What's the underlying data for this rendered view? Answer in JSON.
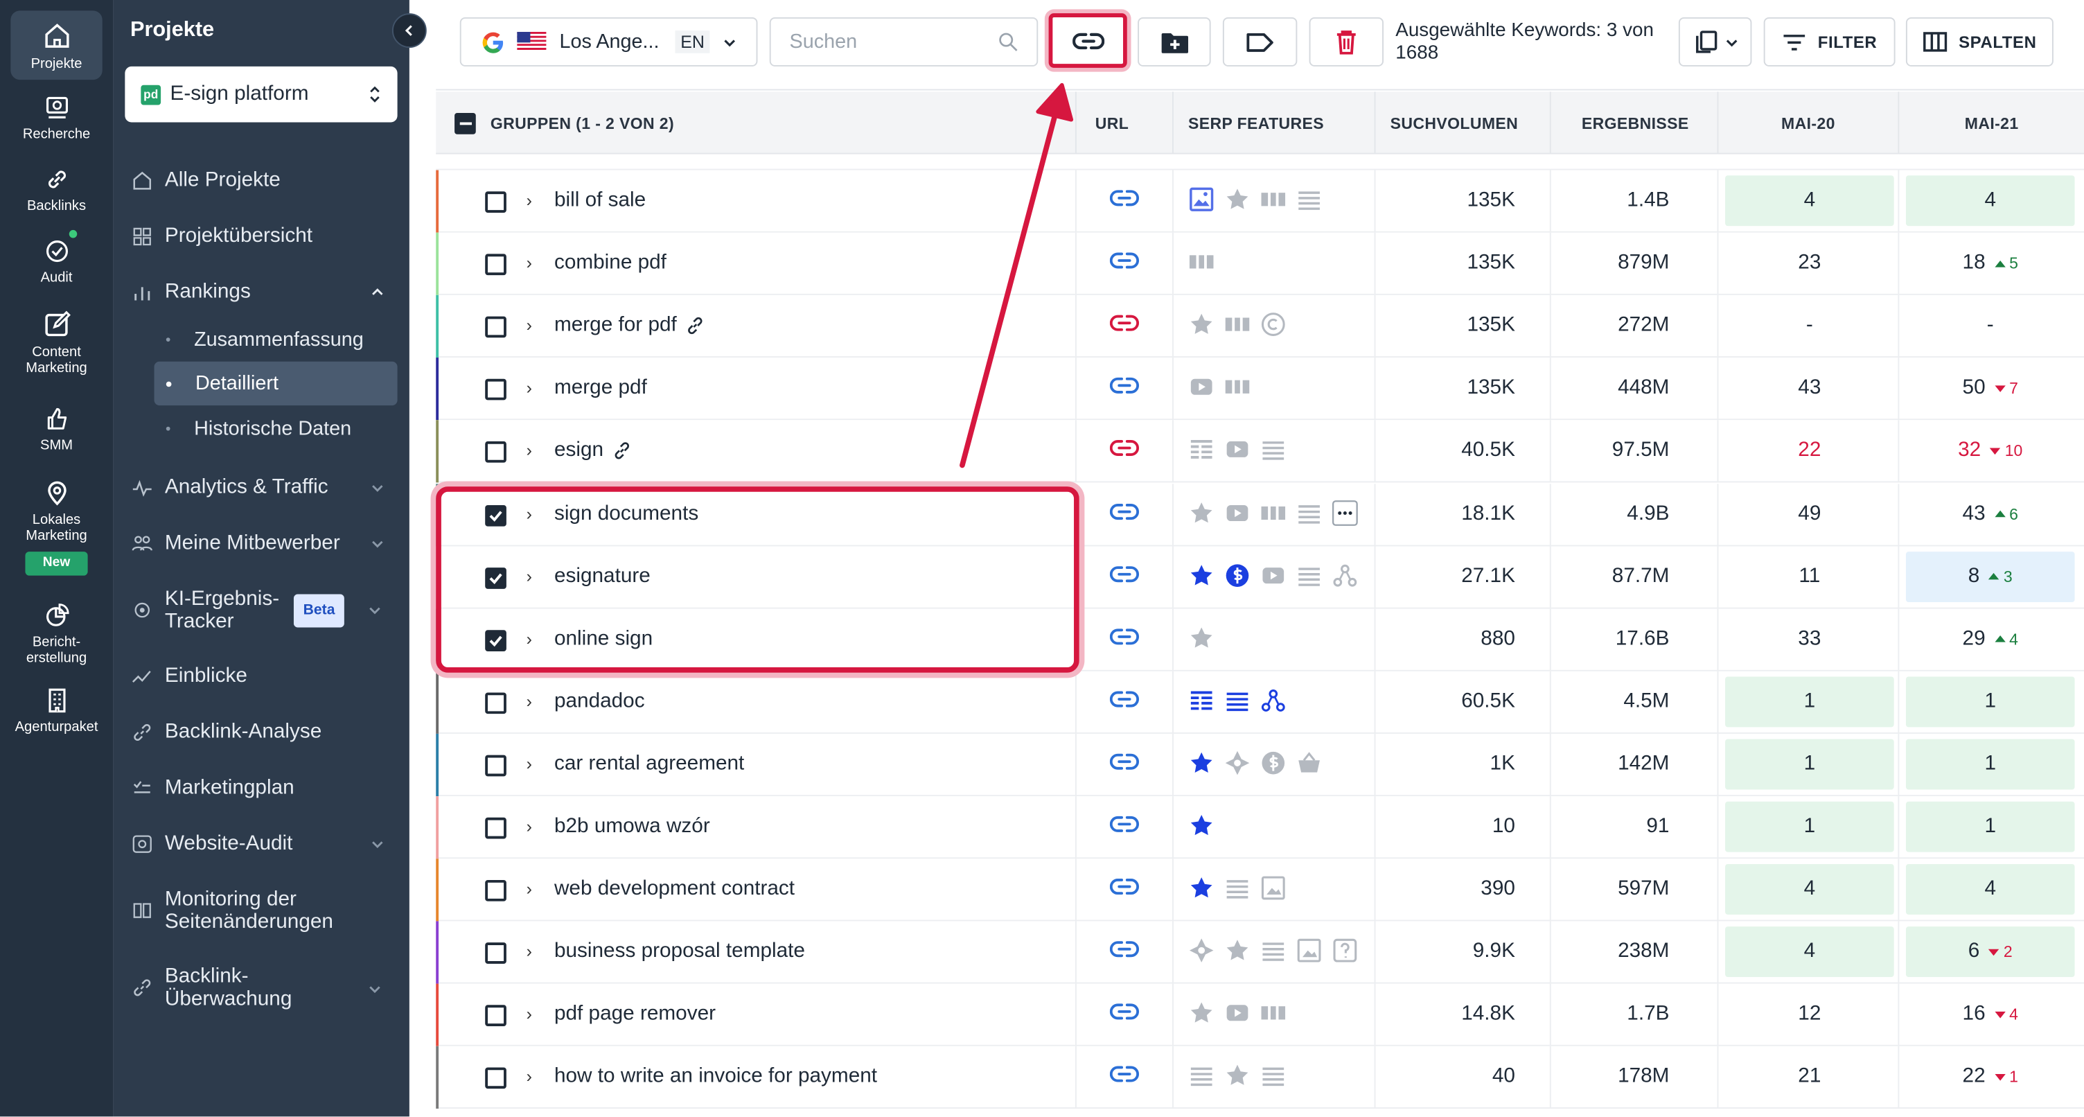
{
  "rail": [
    {
      "label": "Projekte",
      "icon": "home-icon",
      "active": true
    },
    {
      "label": "Recherche",
      "icon": "research-icon"
    },
    {
      "label": "Backlinks",
      "icon": "link-icon"
    },
    {
      "label": "Audit",
      "icon": "audit-icon"
    },
    {
      "label": "Content Marketing",
      "icon": "edit-icon"
    },
    {
      "label": "SMM",
      "icon": "thumbs-up-icon"
    },
    {
      "label": "Lokales Marketing",
      "icon": "location-pin-icon",
      "badge": "New"
    },
    {
      "label": "Bericht-erstellung",
      "icon": "report-icon"
    },
    {
      "label": "Agenturpaket",
      "icon": "building-icon"
    }
  ],
  "side": {
    "title": "Projekte",
    "project": "E-sign platform",
    "project_logo": "pd",
    "nav": {
      "alle": "Alle Projekte",
      "uebersicht": "Projektübersicht",
      "rankings": "Rankings",
      "zusammenfassung": "Zusammenfassung",
      "detailliert": "Detailliert",
      "historische": "Historische Daten",
      "analytics": "Analytics & Traffic",
      "mitbewerber": "Meine Mitbewerber",
      "ki": "KI-Ergebnis-Tracker",
      "ki_badge": "Beta",
      "einblicke": "Einblicke",
      "backlink_analyse": "Backlink-Analyse",
      "marketingplan": "Marketingplan",
      "website_audit": "Website-Audit",
      "monitoring": "Monitoring der Seitenänderungen",
      "backlink_ueberwachung": "Backlink-Überwachung"
    }
  },
  "toolbar": {
    "location": "Los Ange...",
    "language": "EN",
    "search_placeholder": "Suchen",
    "selected_text": "Ausgewählte Keywords: 3 von 1688",
    "filter": "FILTER",
    "columns": "SPALTEN"
  },
  "table": {
    "headers": {
      "groups": "GRUPPEN (1 - 2 VON 2)",
      "url": "URL",
      "serp": "SERP FEATURES",
      "volume": "SUCHVOLUMEN",
      "results": "ERGEBNISSE",
      "d1": "MAI-20",
      "d2": "MAI-21"
    },
    "rows": [
      {
        "kw": "bill of sale",
        "checked": false,
        "bar": "#e66b3c",
        "url_broken": false,
        "url_icon": false,
        "serp": [
          "image",
          "star",
          "carousel",
          "list"
        ],
        "vol": "135K",
        "res": "1.4B",
        "p1": "4",
        "p1bg": "green",
        "p2": "4",
        "p2bg": "green",
        "chg": "",
        "dir": ""
      },
      {
        "kw": "combine pdf",
        "checked": false,
        "bar": "#9be39b",
        "url_broken": false,
        "url_icon": false,
        "serp": [
          "carousel"
        ],
        "vol": "135K",
        "res": "879M",
        "p1": "23",
        "p1bg": "",
        "p2": "18",
        "p2bg": "",
        "chg": "5",
        "dir": "up"
      },
      {
        "kw": "merge for pdf",
        "checked": false,
        "bar": "#3ec0a6",
        "url_broken": true,
        "url_icon": true,
        "serp": [
          "star",
          "carousel",
          "copyright"
        ],
        "vol": "135K",
        "res": "272M",
        "p1": "-",
        "p1bg": "",
        "p2": "-",
        "p2bg": "",
        "chg": "",
        "dir": ""
      },
      {
        "kw": "merge pdf",
        "checked": false,
        "bar": "#2c2c9c",
        "url_broken": false,
        "url_icon": false,
        "serp": [
          "video",
          "carousel"
        ],
        "vol": "135K",
        "res": "448M",
        "p1": "43",
        "p1bg": "",
        "p2": "50",
        "p2bg": "",
        "chg": "7",
        "dir": "dn"
      },
      {
        "kw": "esign",
        "checked": false,
        "bar": "#8a8f5a",
        "url_broken": true,
        "url_icon": true,
        "serp": [
          "table",
          "video",
          "list"
        ],
        "vol": "40.5K",
        "res": "97.5M",
        "p1": "22",
        "p1bg": "",
        "p1red": true,
        "p2": "32",
        "p2bg": "",
        "p2red": true,
        "chg": "10",
        "dir": "dn"
      },
      {
        "kw": "sign documents",
        "checked": true,
        "bar": "#5a8a8a",
        "url_broken": false,
        "url_icon": false,
        "serp": [
          "star",
          "video",
          "carousel",
          "list",
          "more"
        ],
        "vol": "18.1K",
        "res": "4.9B",
        "p1": "49",
        "p1bg": "",
        "p2": "43",
        "p2bg": "",
        "chg": "6",
        "dir": "up"
      },
      {
        "kw": "esignature",
        "checked": true,
        "bar": "#c9c0dd",
        "url_broken": false,
        "url_icon": false,
        "serp": [
          "star-blue",
          "dollar-blue",
          "video",
          "list",
          "network"
        ],
        "vol": "27.1K",
        "res": "87.7M",
        "p1": "11",
        "p1bg": "",
        "p2": "8",
        "p2bg": "blue",
        "chg": "3",
        "dir": "up"
      },
      {
        "kw": "online sign",
        "checked": true,
        "bar": "#2a8f8f",
        "url_broken": false,
        "url_icon": false,
        "serp": [
          "star"
        ],
        "vol": "880",
        "res": "17.6B",
        "p1": "33",
        "p1bg": "",
        "p2": "29",
        "p2bg": "",
        "chg": "4",
        "dir": "up"
      },
      {
        "kw": "pandadoc",
        "checked": false,
        "bar": "#6a6a6a",
        "url_broken": false,
        "url_icon": false,
        "serp": [
          "table-blue",
          "list-blue",
          "network-blue"
        ],
        "vol": "60.5K",
        "res": "4.5M",
        "p1": "1",
        "p1bg": "green",
        "p2": "1",
        "p2bg": "green",
        "chg": "",
        "dir": ""
      },
      {
        "kw": "car rental agreement",
        "checked": false,
        "bar": "#2b7fa8",
        "url_broken": false,
        "url_icon": false,
        "serp": [
          "star-blue",
          "diamond",
          "dollar",
          "basket"
        ],
        "vol": "1K",
        "res": "142M",
        "p1": "1",
        "p1bg": "green",
        "p2": "1",
        "p2bg": "green",
        "chg": "",
        "dir": ""
      },
      {
        "kw": "b2b umowa wzór",
        "checked": false,
        "bar": "#f0a0a0",
        "url_broken": false,
        "url_icon": false,
        "serp": [
          "star-blue"
        ],
        "vol": "10",
        "res": "91",
        "p1": "1",
        "p1bg": "green",
        "p2": "1",
        "p2bg": "green",
        "chg": "",
        "dir": ""
      },
      {
        "kw": "web development contract",
        "checked": false,
        "bar": "#e6862d",
        "url_broken": false,
        "url_icon": false,
        "serp": [
          "star-blue",
          "list",
          "image-light"
        ],
        "vol": "390",
        "res": "597M",
        "p1": "4",
        "p1bg": "green",
        "p2": "4",
        "p2bg": "green",
        "chg": "",
        "dir": ""
      },
      {
        "kw": "business proposal template",
        "checked": false,
        "bar": "#8a3fd1",
        "url_broken": false,
        "url_icon": false,
        "serp": [
          "diamond",
          "star",
          "list",
          "image-light",
          "question"
        ],
        "vol": "9.9K",
        "res": "238M",
        "p1": "4",
        "p1bg": "green",
        "p2": "6",
        "p2bg": "green",
        "chg": "2",
        "dir": "dn"
      },
      {
        "kw": "pdf page remover",
        "checked": false,
        "bar": "#e64a3c",
        "url_broken": false,
        "url_icon": false,
        "serp": [
          "star",
          "video",
          "carousel"
        ],
        "vol": "14.8K",
        "res": "1.7B",
        "p1": "12",
        "p1bg": "",
        "p2": "16",
        "p2bg": "",
        "chg": "4",
        "dir": "dn"
      },
      {
        "kw": "how to write an invoice for payment",
        "checked": false,
        "bar": "#7a7a7a",
        "url_broken": false,
        "url_icon": false,
        "serp": [
          "list",
          "star",
          "list"
        ],
        "vol": "40",
        "res": "178M",
        "p1": "21",
        "p1bg": "",
        "p2": "22",
        "p2bg": "",
        "chg": "1",
        "dir": "dn"
      }
    ]
  },
  "colors": {
    "accent": "#d6173f",
    "link": "#2b6fd6",
    "sidebar": "#2d3b4c",
    "rail": "#243140"
  }
}
